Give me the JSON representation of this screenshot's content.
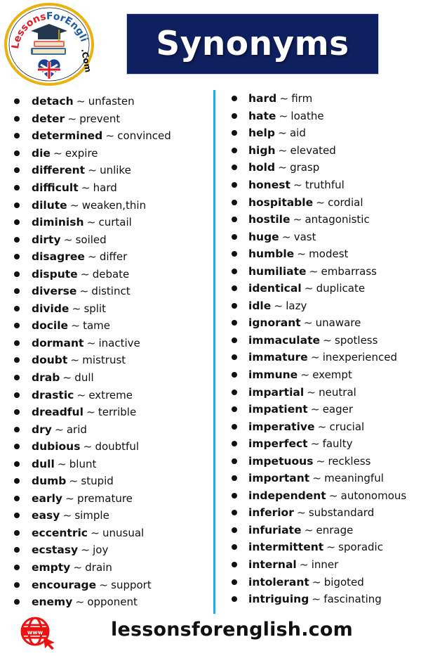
{
  "logo": {
    "top_text_red": "Lessons",
    "top_text_blue": "ForEnglish",
    "suffix": ".Com",
    "colors": {
      "ring": "#e9b20e",
      "red": "#e21b23",
      "blue": "#1c5ea8",
      "cap": "#23374f"
    }
  },
  "title": "Synonyms",
  "colors": {
    "banner": "#0f2060",
    "divider": "#14b2ee",
    "footer_icon": "#ee1111"
  },
  "separator": "~",
  "left_column": [
    {
      "word": "detach",
      "synonym": "unfasten"
    },
    {
      "word": "deter",
      "synonym": "prevent"
    },
    {
      "word": "determined",
      "synonym": "convinced"
    },
    {
      "word": "die",
      "synonym": "expire"
    },
    {
      "word": "different",
      "synonym": "unlike"
    },
    {
      "word": "difficult",
      "synonym": "hard"
    },
    {
      "word": "dilute",
      "synonym": "weaken,thin"
    },
    {
      "word": "diminish",
      "synonym": "curtail"
    },
    {
      "word": "dirty",
      "synonym": "soiled"
    },
    {
      "word": "disagree",
      "synonym": "differ"
    },
    {
      "word": "dispute",
      "synonym": "debate"
    },
    {
      "word": "diverse",
      "synonym": "distinct"
    },
    {
      "word": "divide",
      "synonym": "split"
    },
    {
      "word": "docile",
      "synonym": "tame"
    },
    {
      "word": "dormant",
      "synonym": "inactive"
    },
    {
      "word": "doubt",
      "synonym": "mistrust"
    },
    {
      "word": "drab",
      "synonym": "dull"
    },
    {
      "word": "drastic",
      "synonym": "extreme"
    },
    {
      "word": "dreadful",
      "synonym": "terrible"
    },
    {
      "word": "dry",
      "synonym": "arid"
    },
    {
      "word": "dubious",
      "synonym": "doubtful"
    },
    {
      "word": "dull",
      "synonym": "blunt"
    },
    {
      "word": "dumb",
      "synonym": "stupid"
    },
    {
      "word": "early",
      "synonym": "premature"
    },
    {
      "word": "easy",
      "synonym": "simple"
    },
    {
      "word": "eccentric",
      "synonym": "unusual"
    },
    {
      "word": "ecstasy",
      "synonym": "joy"
    },
    {
      "word": "empty",
      "synonym": "drain"
    },
    {
      "word": "encourage",
      "synonym": "support"
    },
    {
      "word": "enemy",
      "synonym": "opponent"
    }
  ],
  "right_column": [
    {
      "word": "hard",
      "synonym": "firm"
    },
    {
      "word": "hate",
      "synonym": "loathe"
    },
    {
      "word": "help",
      "synonym": "aid"
    },
    {
      "word": "high",
      "synonym": "elevated"
    },
    {
      "word": "hold",
      "synonym": "grasp"
    },
    {
      "word": "honest",
      "synonym": "truthful"
    },
    {
      "word": "hospitable",
      "synonym": "cordial"
    },
    {
      "word": "hostile",
      "synonym": "antagonistic"
    },
    {
      "word": "huge",
      "synonym": "vast"
    },
    {
      "word": "humble",
      "synonym": "modest"
    },
    {
      "word": "humiliate",
      "synonym": "embarrass"
    },
    {
      "word": "identical",
      "synonym": "duplicate"
    },
    {
      "word": "idle",
      "synonym": "lazy"
    },
    {
      "word": "ignorant",
      "synonym": "unaware"
    },
    {
      "word": "immaculate",
      "synonym": "spotless"
    },
    {
      "word": "immature",
      "synonym": "inexperienced"
    },
    {
      "word": "immune",
      "synonym": "exempt"
    },
    {
      "word": "impartial",
      "synonym": "neutral"
    },
    {
      "word": "impatient",
      "synonym": "eager"
    },
    {
      "word": "imperative",
      "synonym": "crucial"
    },
    {
      "word": "imperfect",
      "synonym": "faulty"
    },
    {
      "word": "impetuous",
      "synonym": "reckless"
    },
    {
      "word": "important",
      "synonym": "meaningful"
    },
    {
      "word": "independent",
      "synonym": "autonomous"
    },
    {
      "word": "inferior",
      "synonym": "substandard"
    },
    {
      "word": "infuriate",
      "synonym": "enrage"
    },
    {
      "word": "intermittent",
      "synonym": "sporadic"
    },
    {
      "word": "internal",
      "synonym": "inner"
    },
    {
      "word": "intolerant",
      "synonym": "bigoted"
    },
    {
      "word": "intriguing",
      "synonym": "fascinating"
    }
  ],
  "footer": {
    "icon": "www-globe-cursor-icon",
    "icon_text": "www",
    "url": "lessonsforenglish.com"
  }
}
